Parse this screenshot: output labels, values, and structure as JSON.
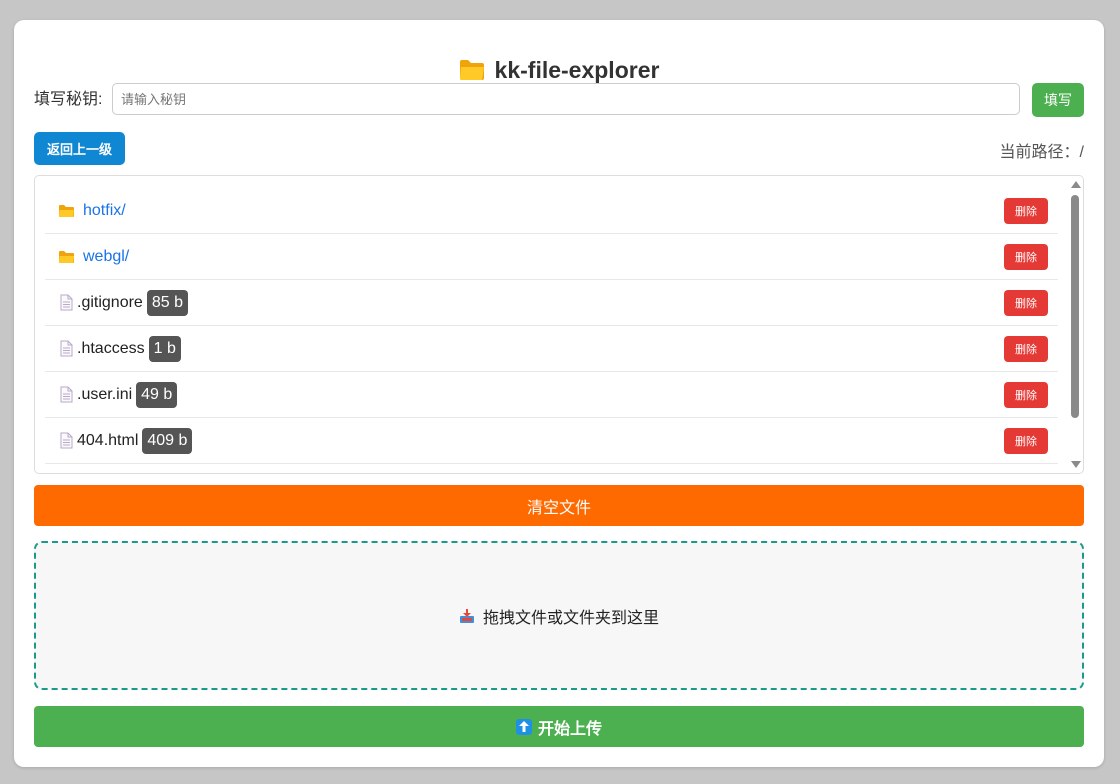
{
  "app": {
    "title": "kk-file-explorer"
  },
  "key": {
    "label": "填写秘钥:",
    "placeholder": "请输入秘钥",
    "value": "",
    "button_label": "填写"
  },
  "nav": {
    "back_label": "返回上一级",
    "current_path_label": "当前路径：/"
  },
  "files": [
    {
      "name": "hotfix/",
      "type": "dir",
      "delete_label": "删除"
    },
    {
      "name": "webgl/",
      "type": "dir",
      "delete_label": "删除"
    },
    {
      "name": ".gitignore",
      "type": "file",
      "size": "85 b",
      "delete_label": "删除"
    },
    {
      "name": ".htaccess",
      "type": "file",
      "size": "1 b",
      "delete_label": "删除"
    },
    {
      "name": ".user.ini",
      "type": "file",
      "size": "49 b",
      "delete_label": "删除"
    },
    {
      "name": "404.html",
      "type": "file",
      "size": "409 b",
      "delete_label": "删除"
    }
  ],
  "actions": {
    "clear_label": "清空文件",
    "drop_label": "拖拽文件或文件夹到这里",
    "upload_label": "开始上传"
  },
  "colors": {
    "primary_green": "#4caf50",
    "back_blue": "#1087d3",
    "danger_red": "#e53935",
    "clear_orange": "#ff6a00",
    "dir_link": "#1a73e8",
    "folder_yellow": "#fbc02d"
  },
  "icons": {
    "title": "folder-icon",
    "dir": "folder-icon",
    "file": "file-icon",
    "drop": "inbox-tray-icon",
    "upload": "up-arrow-icon"
  }
}
